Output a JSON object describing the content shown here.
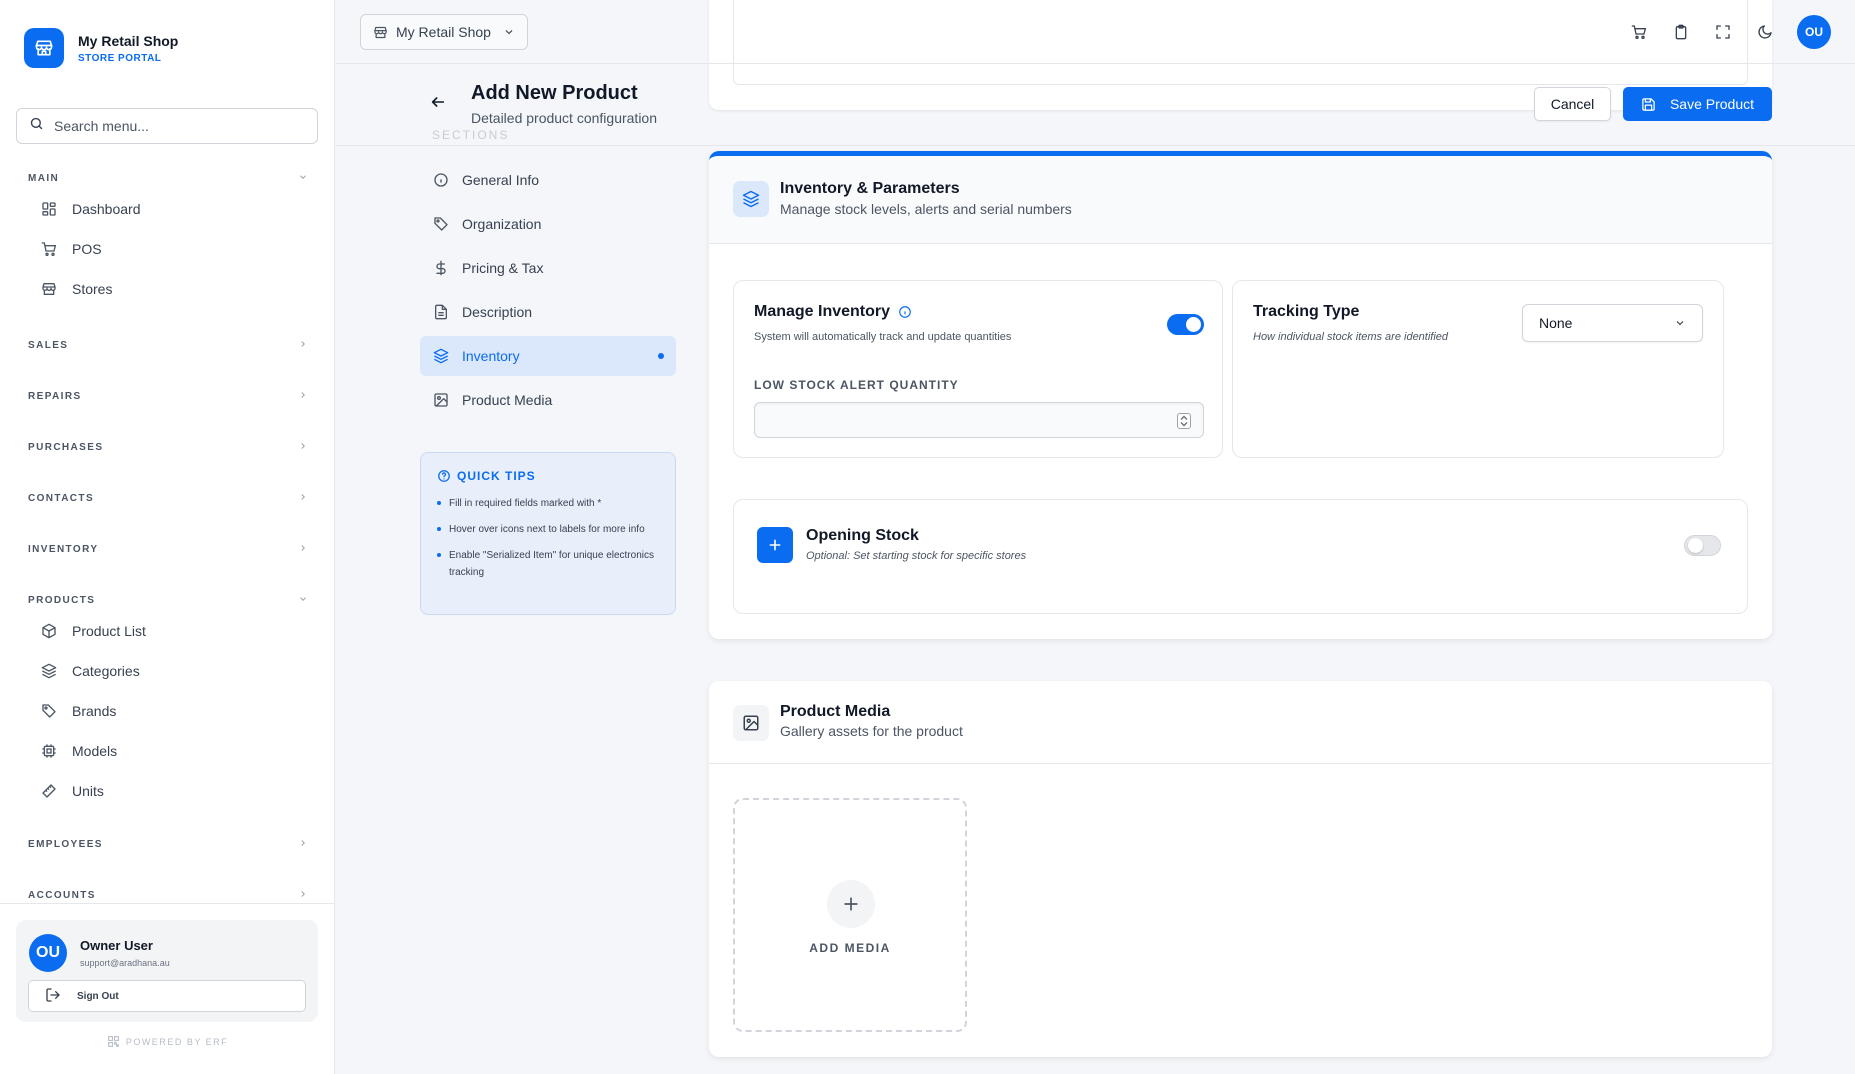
{
  "brand": {
    "title": "My Retail Shop",
    "subtitle": "STORE PORTAL"
  },
  "search": {
    "placeholder": "Search menu..."
  },
  "nav": {
    "main_label": "MAIN",
    "dashboard": "Dashboard",
    "pos": "POS",
    "stores": "Stores",
    "sales": "SALES",
    "repairs": "REPAIRS",
    "purchases": "PURCHASES",
    "contacts": "CONTACTS",
    "inventory": "INVENTORY",
    "products_label": "PRODUCTS",
    "product_list": "Product List",
    "categories": "Categories",
    "brands": "Brands",
    "models": "Models",
    "units": "Units",
    "employees": "EMPLOYEES",
    "accounts": "ACCOUNTS"
  },
  "user": {
    "initials": "OU",
    "name": "Owner User",
    "email": "support@aradhana.au",
    "signout": "Sign Out"
  },
  "powered": "POWERED BY ERF",
  "topbar": {
    "shop": "My Retail Shop",
    "avatar": "OU"
  },
  "page": {
    "title": "Add New Product",
    "subtitle": "Detailed product configuration",
    "sections_label": "SECTIONS"
  },
  "actions": {
    "cancel": "Cancel",
    "save": "Save Product"
  },
  "sections": {
    "general": "General Info",
    "organization": "Organization",
    "pricing": "Pricing & Tax",
    "description": "Description",
    "inventory": "Inventory",
    "media": "Product Media"
  },
  "tips": {
    "title": "QUICK TIPS",
    "items": [
      "Fill in required fields marked with *",
      "Hover over icons next to labels for more info",
      "Enable \"Serialized Item\" for unique electronics tracking"
    ]
  },
  "inventory_card": {
    "title": "Inventory & Parameters",
    "subtitle": "Manage stock levels, alerts and serial numbers",
    "manage": {
      "title": "Manage Inventory",
      "subtitle": "System will automatically track and update quantities",
      "enabled": true
    },
    "low_stock_label": "LOW STOCK ALERT QUANTITY",
    "low_stock_value": "",
    "tracking": {
      "title": "Tracking Type",
      "subtitle": "How individual stock items are identified",
      "value": "None"
    },
    "opening": {
      "title": "Opening Stock",
      "subtitle": "Optional: Set starting stock for specific stores",
      "enabled": false
    }
  },
  "media_card": {
    "title": "Product Media",
    "subtitle": "Gallery assets for the product",
    "add_label": "ADD MEDIA"
  },
  "colors": {
    "accent": "#0a6cf0",
    "active_bg": "#dbe7fb"
  }
}
